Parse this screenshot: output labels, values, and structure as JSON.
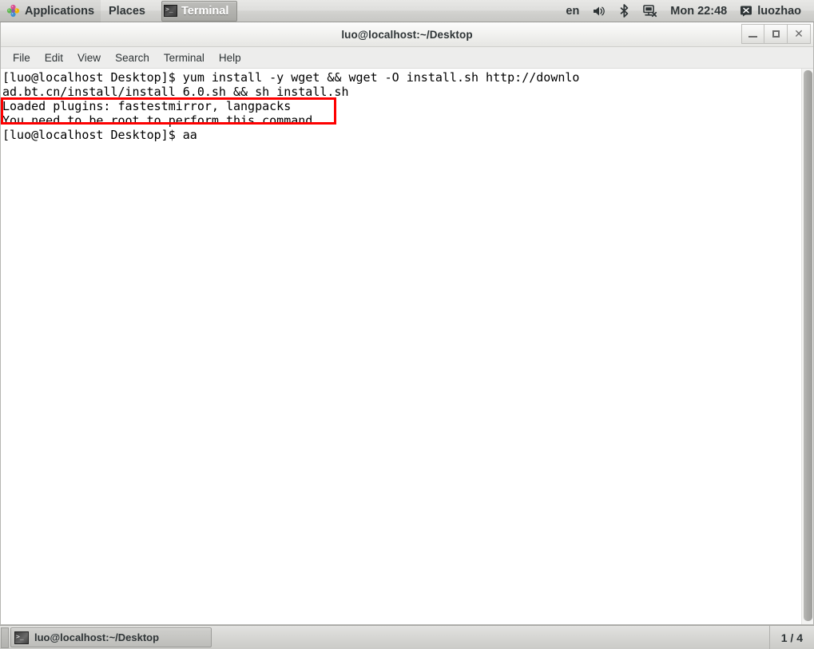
{
  "top_panel": {
    "applications_label": "Applications",
    "applications_icon": "applications-pinwheel-icon",
    "places_label": "Places",
    "window_task_label": "Terminal",
    "window_task_icon": "terminal-icon",
    "tray": {
      "keyboard_layout": "en",
      "volume_icon": "volume-icon",
      "bluetooth_icon": "bluetooth-icon",
      "network_icon": "network-disconnected-icon",
      "clock": "Mon 22:48",
      "user_icon": "user-status-icon",
      "user_name": "luozhao"
    }
  },
  "window": {
    "title": "luo@localhost:~/Desktop",
    "buttons": {
      "minimize": "minimize-button",
      "maximize": "maximize-button",
      "close": "close-button",
      "close_glyph": "✕"
    },
    "menubar": [
      "File",
      "Edit",
      "View",
      "Search",
      "Terminal",
      "Help"
    ]
  },
  "terminal": {
    "lines": [
      "[luo@localhost Desktop]$ yum install -y wget && wget -O install.sh http://downlo",
      "ad.bt.cn/install/install 6.0.sh && sh install.sh",
      "Loaded plugins: fastestmirror, langpacks",
      "You need to be root to perform this command.",
      "[luo@localhost Desktop]$ aa"
    ],
    "text": "[luo@localhost Desktop]$ yum install -y wget && wget -O install.sh http://downlo\nad.bt.cn/install/install 6.0.sh && sh install.sh\nLoaded plugins: fastestmirror, langpacks\nYou need to be root to perform this command.\n[luo@localhost Desktop]$ aa",
    "annotation": {
      "name": "red-highlight-box",
      "color": "#fe0000",
      "covers": "Loaded plugins: fastestmirror, langpacks / You need to be root to perform this command."
    }
  },
  "bottom_panel": {
    "task_label": "luo@localhost:~/Desktop",
    "task_icon": "terminal-icon",
    "workspace_indicator": "1 / 4"
  }
}
